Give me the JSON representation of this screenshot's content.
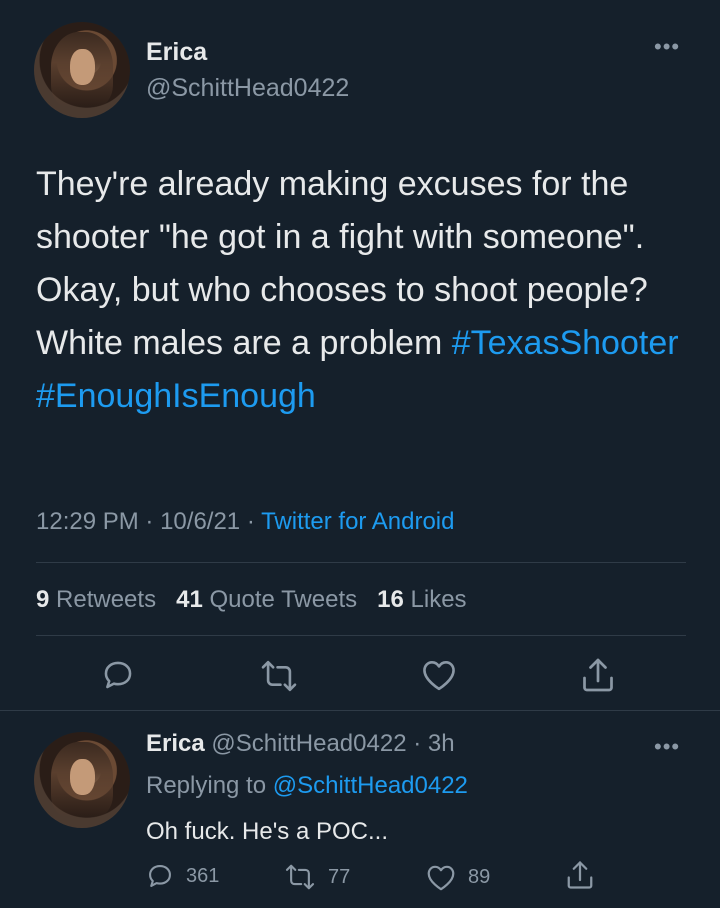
{
  "colors": {
    "background": "#15202b",
    "text": "#e7e9ea",
    "muted": "#8b98a5",
    "link": "#1d9bf0",
    "divider": "#2f3b47"
  },
  "main_tweet": {
    "display_name": "Erica",
    "handle": "@SchittHead0422",
    "text_plain": "They're already making excuses for the shooter \"he got in a fight with someone\". Okay, but who chooses to shoot people? White males are a problem ",
    "hashtag_1": "#TexasShooter",
    "hashtag_2": "#EnoughIsEnough",
    "time": "12:29 PM",
    "date": "10/6/21",
    "source": "Twitter for Android",
    "retweets_count": "9",
    "retweets_label": "Retweets",
    "quote_count": "41",
    "quote_label": "Quote Tweets",
    "likes_count": "16",
    "likes_label": "Likes",
    "icons": [
      "more-icon",
      "reply-icon",
      "retweet-icon",
      "like-icon",
      "share-icon"
    ]
  },
  "reply_tweet": {
    "display_name": "Erica",
    "handle": "@SchittHead0422",
    "age": "3h",
    "replying_prefix": "Replying to",
    "replying_to": "@SchittHead0422",
    "text": "Oh fuck. He's a POC...",
    "reply_count": "361",
    "retweet_count": "77",
    "like_count": "89",
    "icons": [
      "more-icon",
      "reply-icon",
      "retweet-icon",
      "like-icon",
      "share-icon"
    ]
  },
  "separators": {
    "dot": "·"
  }
}
